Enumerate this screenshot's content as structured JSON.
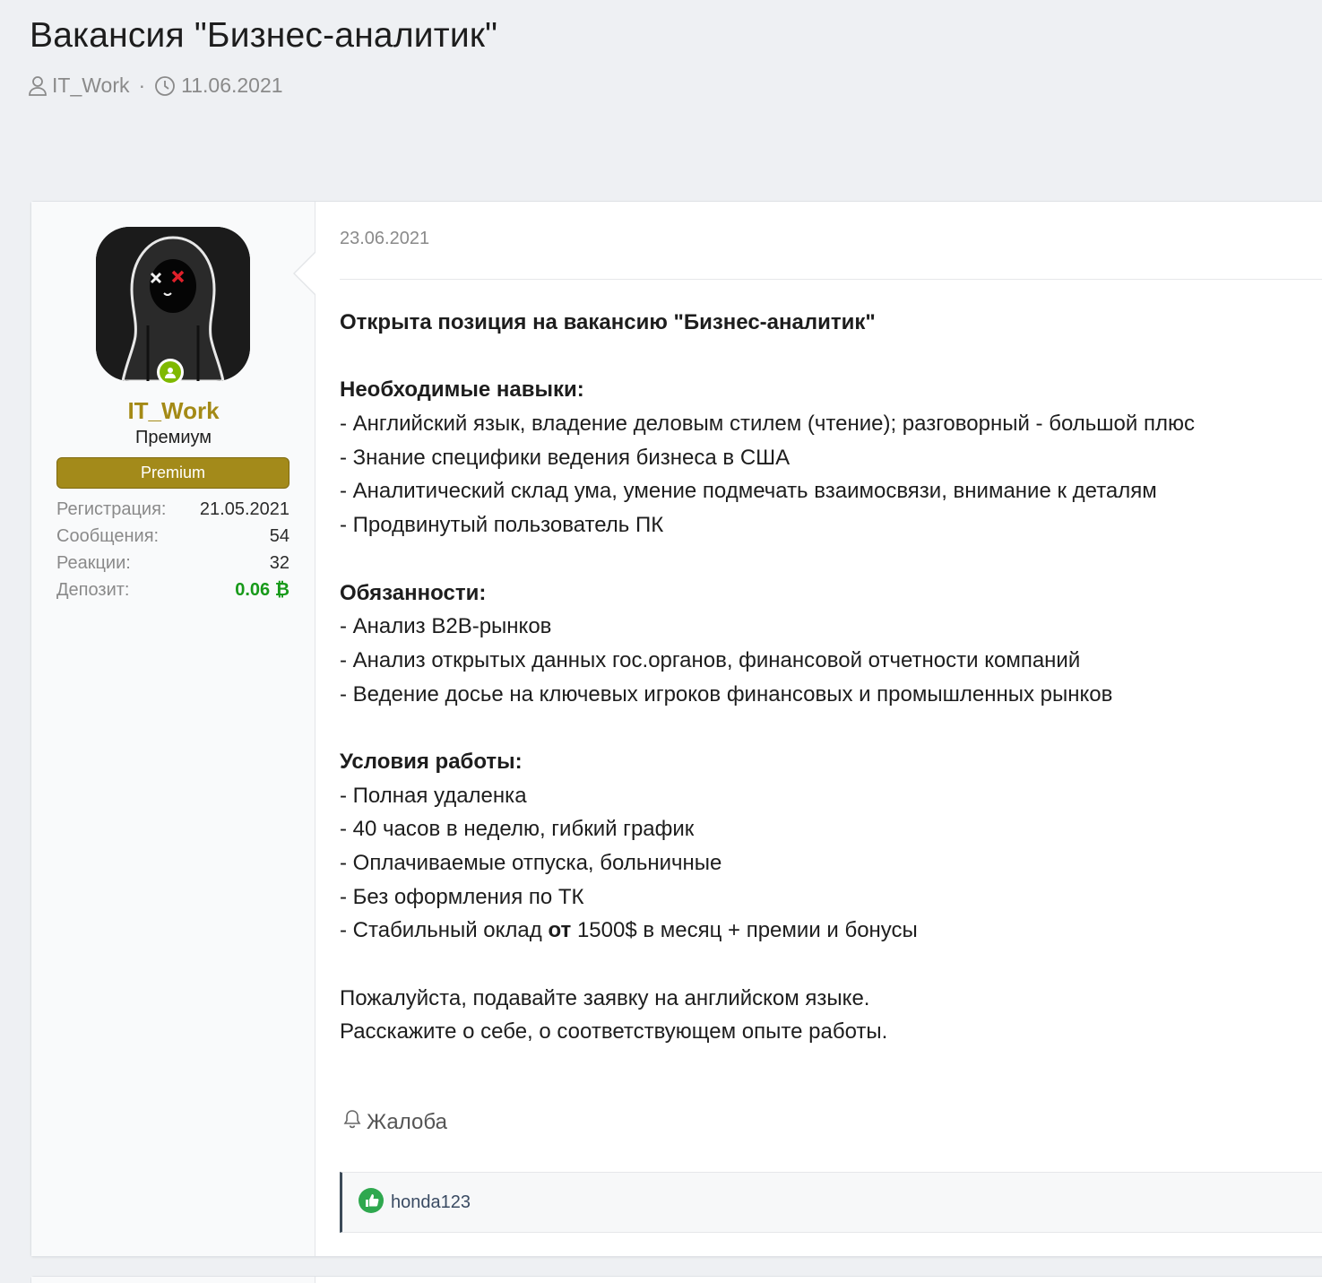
{
  "thread": {
    "title": "Вакансия \"Бизнес-аналитик\"",
    "author": "IT_Work",
    "separator": "·",
    "date": "11.06.2021"
  },
  "post": {
    "user": {
      "name": "IT_Work",
      "title": "Премиум",
      "banner": "Premium",
      "stats": [
        {
          "label": "Регистрация:",
          "value": "21.05.2021"
        },
        {
          "label": "Сообщения:",
          "value": "54"
        },
        {
          "label": "Реакции:",
          "value": "32"
        },
        {
          "label": "Депозит:",
          "value": "0.06 ₿"
        }
      ]
    },
    "date": "23.06.2021",
    "heading": "Открыта позиция на вакансию \"Бизнес-аналитик\"",
    "skills_title": "Необходимые навыки:",
    "skills": [
      "- Английский язык, владение деловым стилем (чтение); разговорный - большой плюс",
      "- Знание специфики ведения бизнеса в США",
      "- Аналитический склад ума, умение подмечать взаимосвязи, внимание к деталям",
      "- Продвинутый пользователь ПК"
    ],
    "duties_title": "Обязанности:",
    "duties": [
      "- Анализ B2B-рынков",
      "- Анализ открытых данных гос.органов, финансовой отчетности компаний",
      "- Ведение досье на ключевых игроков финансовых и промышленных рынков"
    ],
    "conditions_title": "Условия работы:",
    "conditions": [
      "- Полная удаленка",
      "- 40 часов в неделю, гибкий график",
      "- Оплачиваемые отпуска, больничные",
      "- Без оформления по ТК"
    ],
    "salary": {
      "prefix": "- Стабильный оклад ",
      "bold": "от",
      "suffix": " 1500$ в месяц + премии и бонусы"
    },
    "closing": [
      "Пожалуйста, подавайте заявку на английском языке.",
      "Расскажите о себе, о соответствующем опыте работы."
    ],
    "report_label": "Жалоба",
    "reaction_user": "honda123"
  },
  "colors": {
    "accent_gold": "#a48a16",
    "online_green": "#7fb900",
    "deposit_green": "#189a1a",
    "like_green": "#2fa84f"
  },
  "icons": [
    "user-icon",
    "clock-icon",
    "online-indicator-icon",
    "bell-icon",
    "like-icon"
  ]
}
